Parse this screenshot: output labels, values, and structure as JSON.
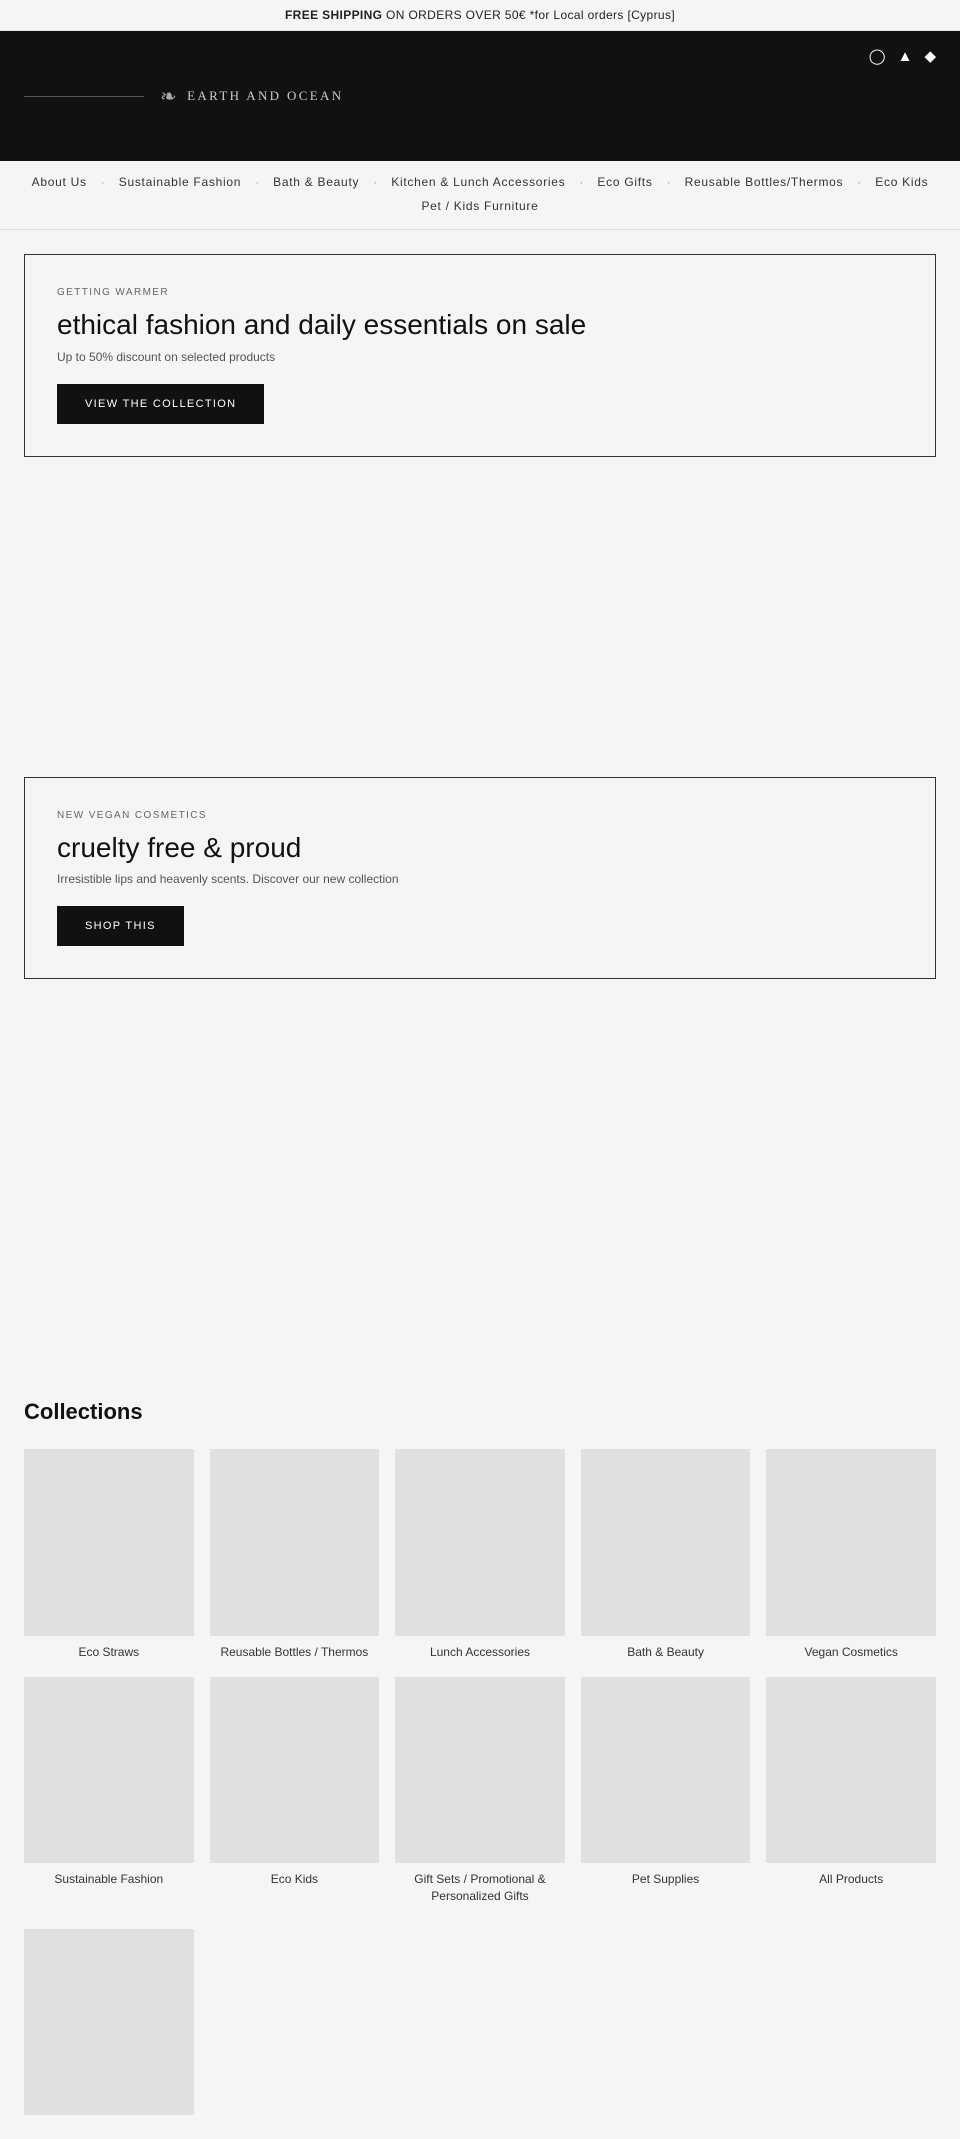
{
  "banner": {
    "text_bold": "FREE SHIPPING",
    "text_rest": " ON ORDERS OVER 50€ *for Local orders [Cyprus]"
  },
  "header": {
    "logo_text": "EARTH AND OCEAN",
    "social_icons": [
      "instagram-icon",
      "facebook-icon",
      "tiktok-icon"
    ]
  },
  "nav": {
    "items": [
      "About Us",
      "Sustainable Fashion",
      "Bath & Beauty",
      "Kitchen & Lunch Accessories",
      "Eco Gifts",
      "Reusable Bottles/Thermos",
      "Eco Kids"
    ],
    "items_row2": [
      "Pet / Kids Furniture"
    ]
  },
  "hero1": {
    "tag": "GETTING WARMER",
    "title": "ethical fashion and daily essentials on sale",
    "subtitle": "Up to 50% discount on selected products",
    "button": "VIEW THE COLLECTION"
  },
  "hero2": {
    "tag": "NEW VEGAN COSMETICS",
    "title": "cruelty free & proud",
    "subtitle": "Irresistible lips and heavenly scents. Discover our new collection",
    "button": "SHOP THIS"
  },
  "collections": {
    "heading": "Collections",
    "items": [
      {
        "label": "Eco Straws"
      },
      {
        "label": "Reusable Bottles / Thermos"
      },
      {
        "label": "Lunch Accessories"
      },
      {
        "label": "Bath & Beauty"
      },
      {
        "label": "Vegan Cosmetics"
      },
      {
        "label": "Sustainable Fashion"
      },
      {
        "label": "Eco Kids"
      },
      {
        "label": "Gift Sets / Promotional & Personalized Gifts"
      },
      {
        "label": "Pet Supplies"
      },
      {
        "label": "All Products"
      }
    ]
  }
}
